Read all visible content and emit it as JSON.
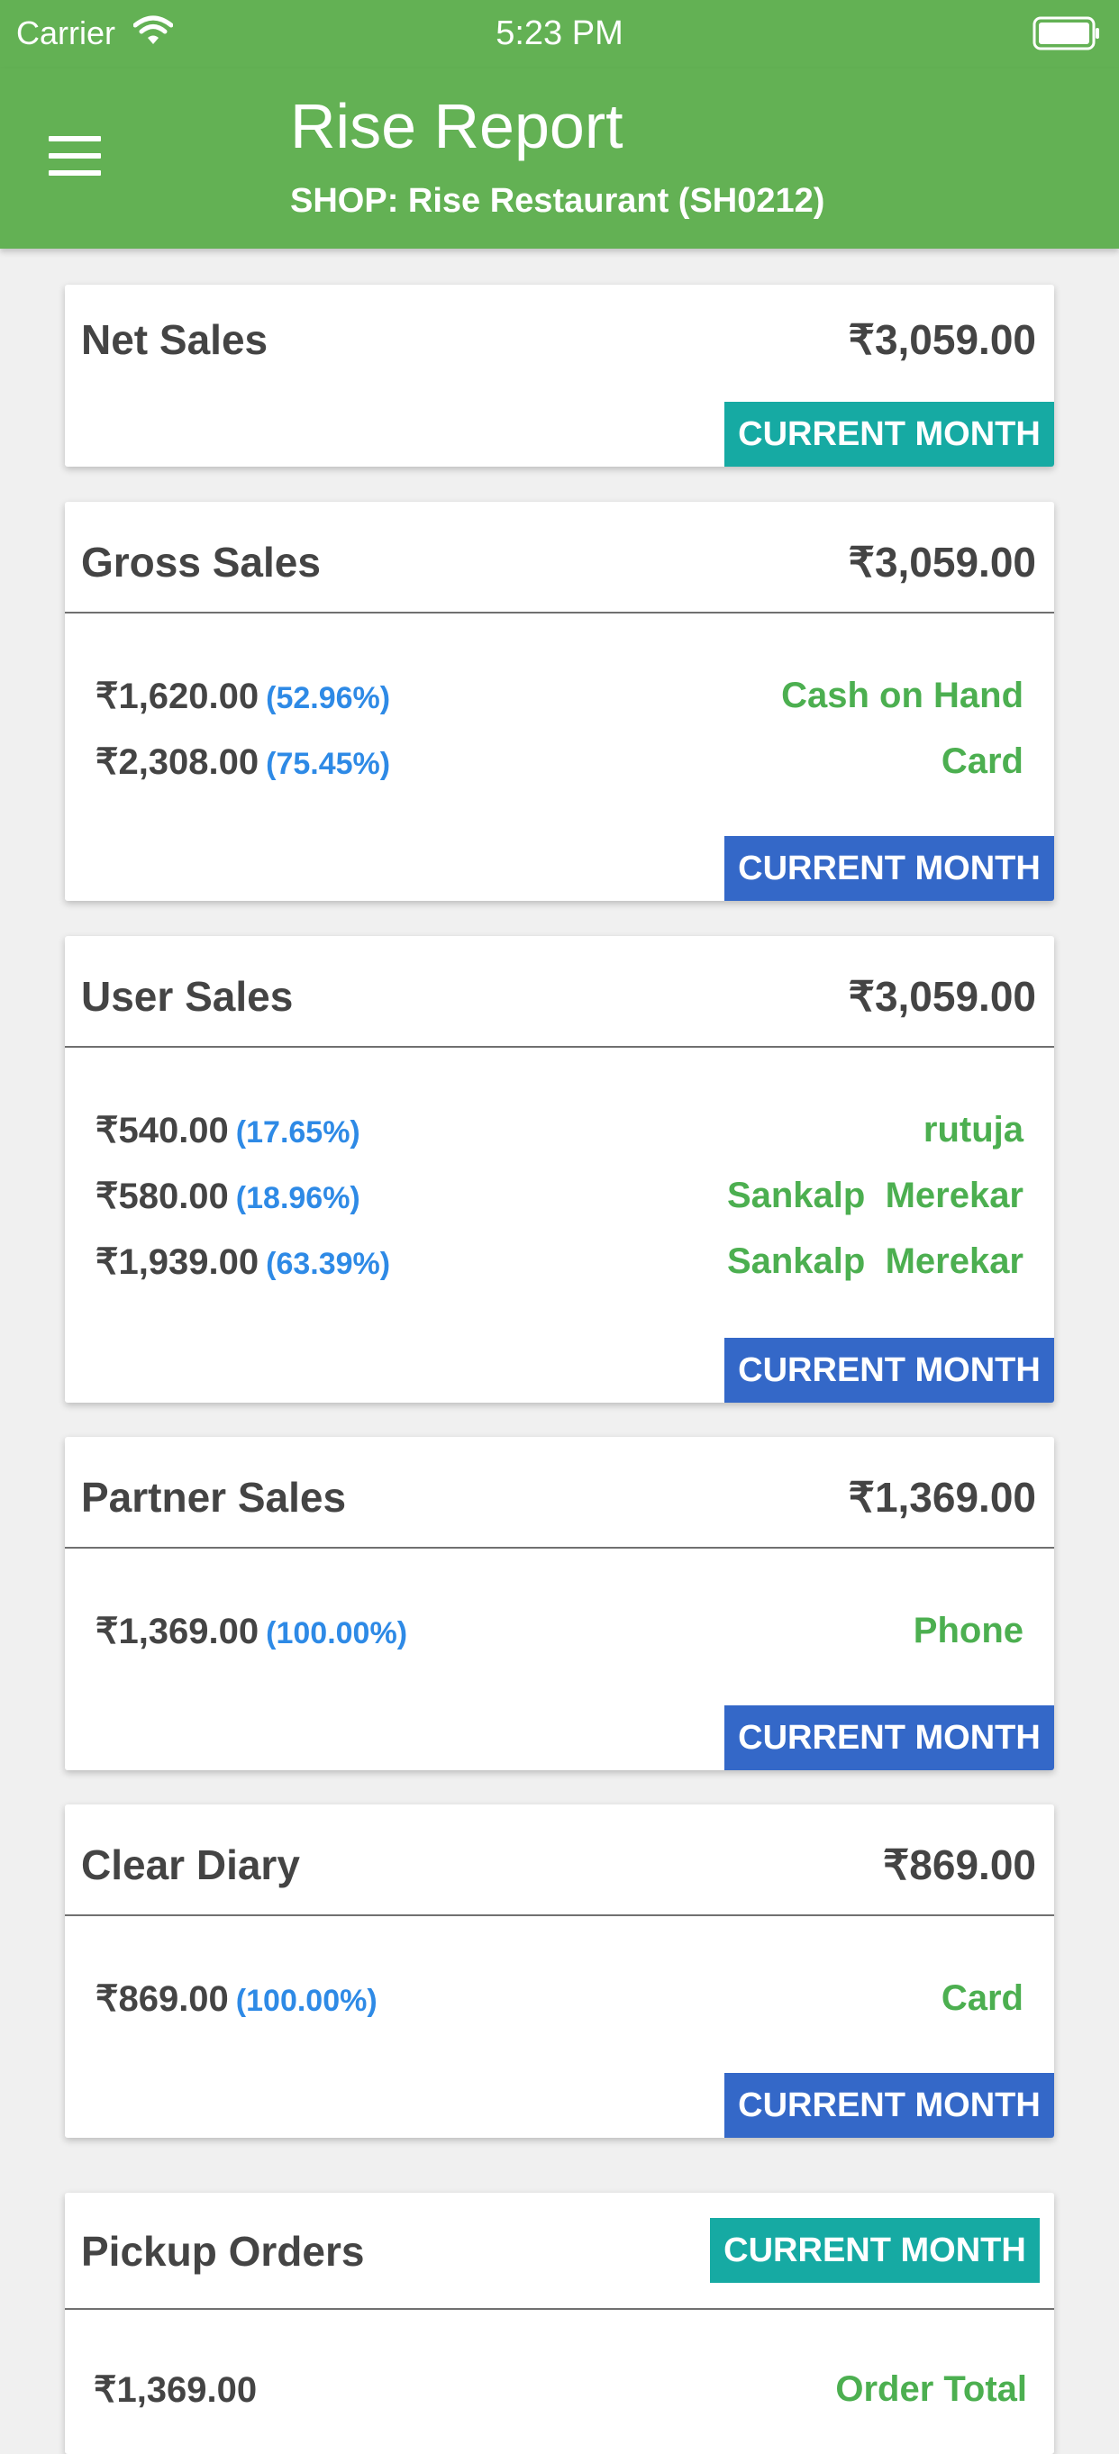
{
  "status_bar": {
    "carrier": "Carrier",
    "time": "5:23 PM",
    "icons": [
      "wifi-icon",
      "battery-icon"
    ]
  },
  "header": {
    "title": "Rise Report",
    "subtitle": "SHOP: Rise Restaurant (SH0212)",
    "menu_icon": "menu-icon"
  },
  "colors": {
    "header_bg": "#63b154",
    "badge_teal": "#16aaa3",
    "badge_blue": "#3468c8",
    "label_green": "#4caf50",
    "pct_blue": "#2e8ae6"
  },
  "cards": [
    {
      "title": "Net Sales",
      "total": "₹3,059.00",
      "badge": "CURRENT MONTH",
      "rows": []
    },
    {
      "title": "Gross Sales",
      "total": "₹3,059.00",
      "badge": "CURRENT MONTH",
      "rows": [
        {
          "amount": "₹1,620.00",
          "pct": "(52.96%)",
          "label": "Cash on Hand"
        },
        {
          "amount": "₹2,308.00",
          "pct": "(75.45%)",
          "label": "Card"
        }
      ]
    },
    {
      "title": "User Sales",
      "total": "₹3,059.00",
      "badge": "CURRENT MONTH",
      "rows": [
        {
          "amount": "₹540.00",
          "pct": "(17.65%)",
          "label": "rutuja"
        },
        {
          "amount": "₹580.00",
          "pct": "(18.96%)",
          "label": "Sankalp  Merekar"
        },
        {
          "amount": "₹1,939.00",
          "pct": "(63.39%)",
          "label": "Sankalp  Merekar"
        }
      ]
    },
    {
      "title": "Partner Sales",
      "total": "₹1,369.00",
      "badge": "CURRENT MONTH",
      "rows": [
        {
          "amount": "₹1,369.00",
          "pct": "(100.00%)",
          "label": "Phone"
        }
      ]
    },
    {
      "title": "Clear Diary",
      "total": "₹869.00",
      "badge": "CURRENT MONTH",
      "rows": [
        {
          "amount": "₹869.00",
          "pct": "(100.00%)",
          "label": "Card"
        }
      ]
    },
    {
      "title": "Pickup Orders",
      "badge": "CURRENT MONTH",
      "rows": [
        {
          "amount": "₹1,369.00",
          "label": "Order Total"
        }
      ]
    }
  ]
}
